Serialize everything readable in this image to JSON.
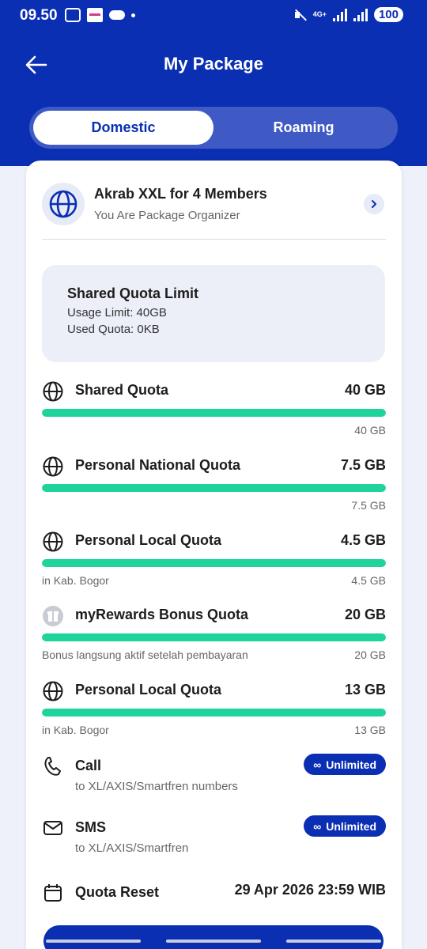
{
  "status": {
    "time": "09.50",
    "network": "4G+",
    "battery": "100"
  },
  "header": {
    "title": "My Package"
  },
  "tabs": [
    {
      "label": "Domestic"
    },
    {
      "label": "Roaming"
    }
  ],
  "package": {
    "name": "Akrab XXL for 4 Members",
    "role": "You Are Package Organizer"
  },
  "limit": {
    "title": "Shared Quota Limit",
    "usage": "Usage Limit: 40GB",
    "used": "Used Quota: 0KB"
  },
  "quotas": [
    {
      "name": "Shared Quota",
      "amount": "40 GB",
      "note": "",
      "remaining": "40 GB",
      "fill_pct": 100,
      "icon": "globe-icon"
    },
    {
      "name": "Personal National Quota",
      "amount": "7.5 GB",
      "note": "",
      "remaining": "7.5 GB",
      "fill_pct": 100,
      "icon": "globe-icon"
    },
    {
      "name": "Personal Local Quota",
      "amount": "4.5 GB",
      "note": "in Kab. Bogor",
      "remaining": "4.5 GB",
      "fill_pct": 100,
      "icon": "globe-icon"
    },
    {
      "name": "myRewards Bonus Quota",
      "amount": "20 GB",
      "note": "Bonus langsung aktif setelah pembayaran",
      "remaining": "20 GB",
      "fill_pct": 100,
      "icon": "gift-icon"
    },
    {
      "name": "Personal Local Quota",
      "amount": "13 GB",
      "note": "in Kab. Bogor",
      "remaining": "13 GB",
      "fill_pct": 100,
      "icon": "globe-icon"
    }
  ],
  "services": [
    {
      "name": "Call",
      "desc": "to XL/AXIS/Smartfren numbers",
      "badge": "Unlimited",
      "icon": "phone-icon"
    },
    {
      "name": "SMS",
      "desc": "to XL/AXIS/Smartfren",
      "badge": "Unlimited",
      "icon": "envelope-icon"
    }
  ],
  "reset": {
    "label": "Quota Reset",
    "date": "29 Apr 2026 23:59 WIB"
  },
  "colors": {
    "primary": "#0a2fb3",
    "progress": "#1ed49a",
    "background": "#eef0fa"
  }
}
